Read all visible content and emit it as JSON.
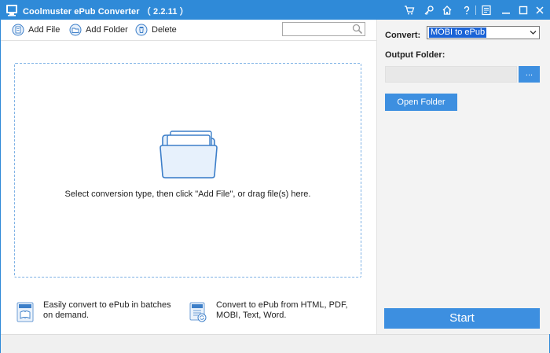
{
  "window": {
    "title": "Coolmuster ePub Converter （ 2.2.11 ）",
    "accent_color": "#2f8ad8",
    "controls": [
      "cart-icon",
      "key-icon",
      "home-icon",
      "help-icon",
      "feedback-icon",
      "minimize-icon",
      "maximize-icon",
      "close-icon"
    ]
  },
  "toolbar": {
    "add_file_label": "Add File",
    "add_folder_label": "Add Folder",
    "delete_label": "Delete",
    "search_value": "",
    "search_placeholder": ""
  },
  "dropzone": {
    "hint": "Select conversion type, then click \"Add File\", or drag file(s) here."
  },
  "features": [
    {
      "icon": "epub-book-icon",
      "text": "Easily convert to ePub in batches on demand."
    },
    {
      "icon": "epub-convert-icon",
      "text": "Convert to ePub from HTML, PDF, MOBI, Text, Word."
    }
  ],
  "panel": {
    "convert_label": "Convert:",
    "convert_value": "MOBI to ePub",
    "output_label": "Output Folder:",
    "output_value": "",
    "browse_label": "...",
    "open_folder_label": "Open Folder",
    "start_label": "Start",
    "button_color": "#3d8fe0"
  }
}
